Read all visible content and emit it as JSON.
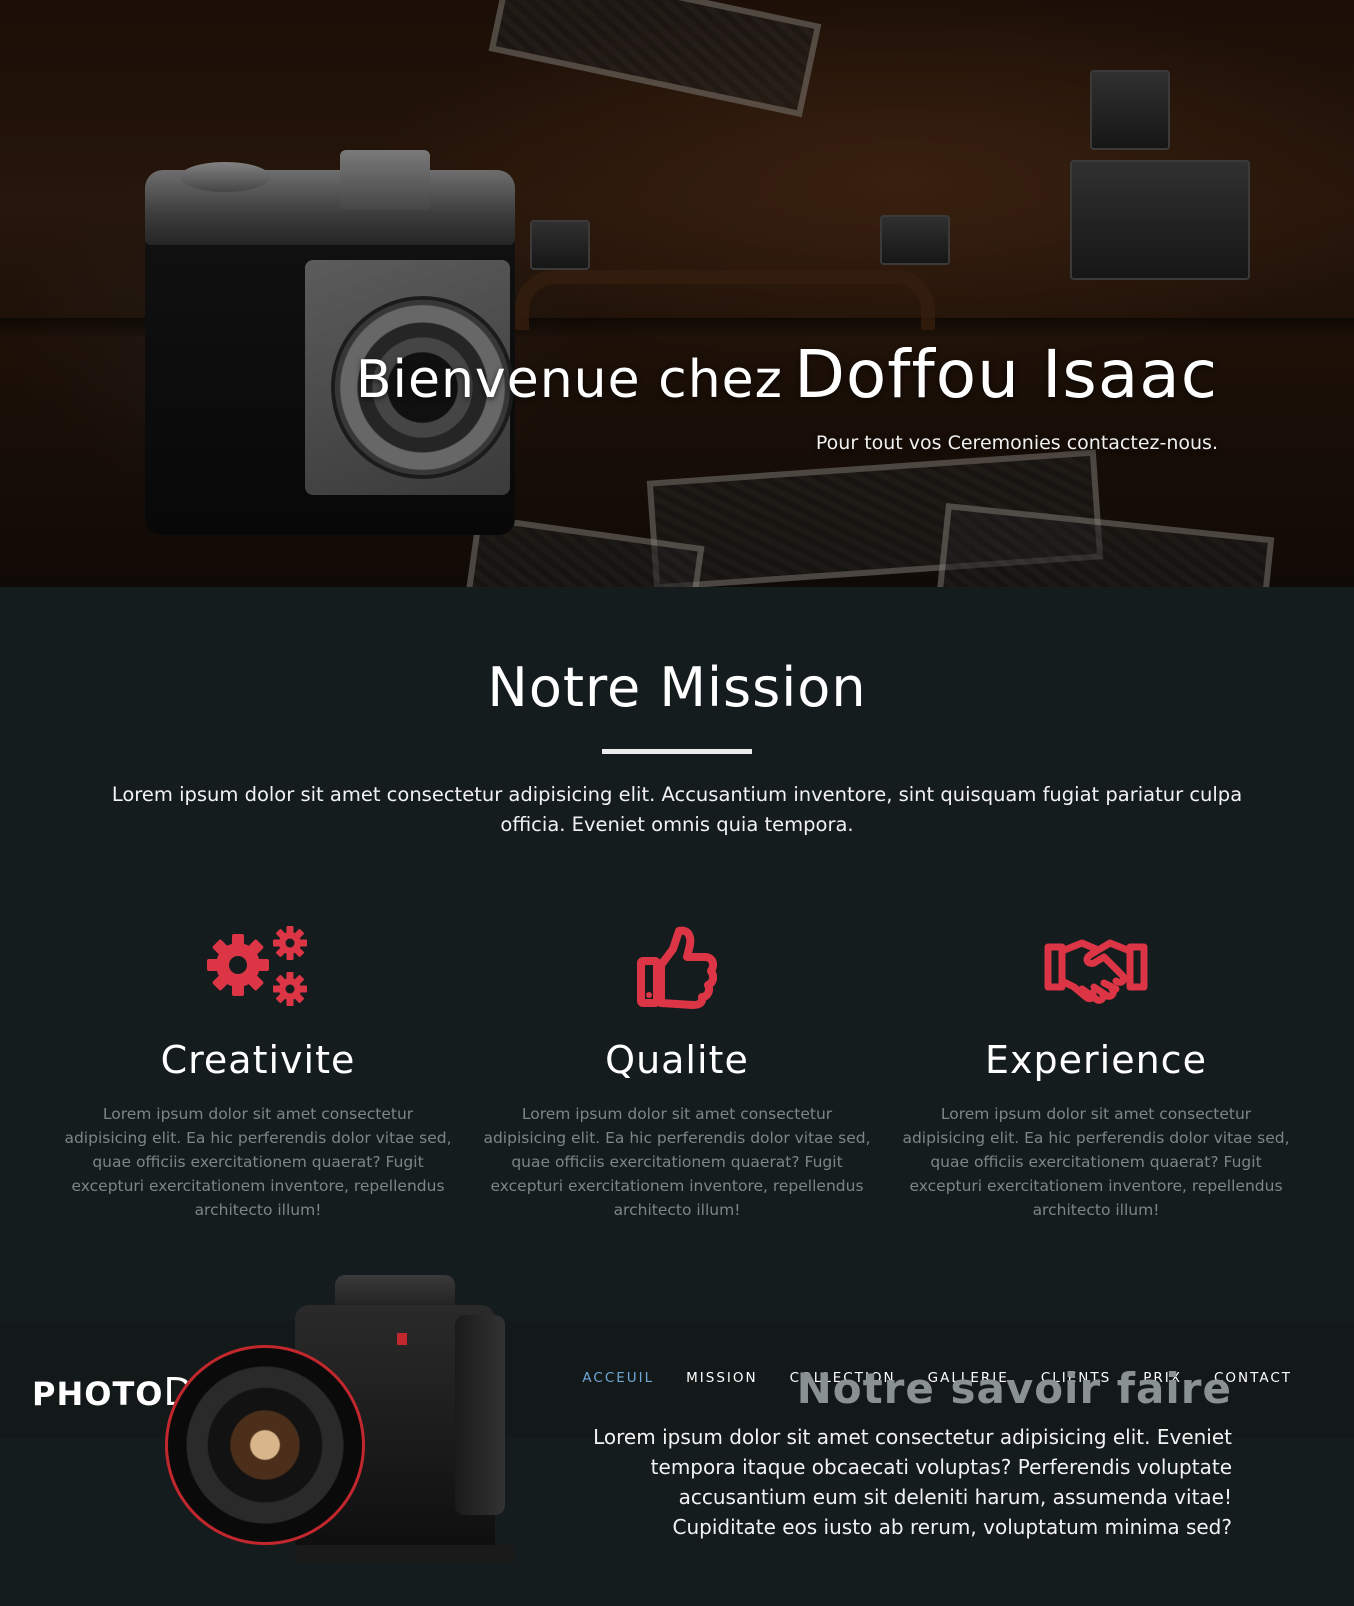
{
  "hero": {
    "title_lead": "Bienvenue chez",
    "title_name": "Doffou Isaac",
    "subtitle": "Pour tout vos Ceremonies contactez-nous."
  },
  "mission": {
    "title": "Notre Mission",
    "text": "Lorem ipsum dolor sit amet consectetur adipisicing elit. Accusantium inventore, sint quisquam fugiat pariatur culpa officia. Eveniet omnis quia tempora."
  },
  "features": [
    {
      "icon": "gears-icon",
      "title": "Creativite",
      "text": "Lorem ipsum dolor sit amet consectetur adipisicing elit. Ea hic perferendis dolor vitae sed, quae officiis exercitationem quaerat? Fugit excepturi exercitationem inventore, repellendus architecto illum!"
    },
    {
      "icon": "thumbs-up-icon",
      "title": "Qualite",
      "text": "Lorem ipsum dolor sit amet consectetur adipisicing elit. Ea hic perferendis dolor vitae sed, quae officiis exercitationem quaerat? Fugit excepturi exercitationem inventore, repellendus architecto illum!"
    },
    {
      "icon": "handshake-icon",
      "title": "Experience",
      "text": "Lorem ipsum dolor sit amet consectetur adipisicing elit. Ea hic perferendis dolor vitae sed, quae officiis exercitationem quaerat? Fugit excepturi exercitationem inventore, repellendus architecto illum!"
    }
  ],
  "brand": {
    "part1": "PHOTO",
    "part2": "DOF"
  },
  "nav": {
    "items": [
      "ACCEUIL",
      "MISSION",
      "COLLECTION",
      "GALLERIE",
      "CLIENTS",
      "PRIX",
      "CONTACT"
    ],
    "active": "ACCEUIL"
  },
  "savoir": {
    "title": "Notre savoir faire",
    "text": "Lorem ipsum dolor sit amet consectetur adipisicing elit. Eveniet tempora itaque obcaecati voluptas? Perferendis voluptate accusantium eum sit deleniti harum, assumenda vitae! Cupiditate eos iusto ab rerum, voluptatum minima sed?"
  },
  "colors": {
    "accent_red": "#dc3545",
    "nav_active": "#6fa8d8",
    "background": "#151c1e"
  }
}
